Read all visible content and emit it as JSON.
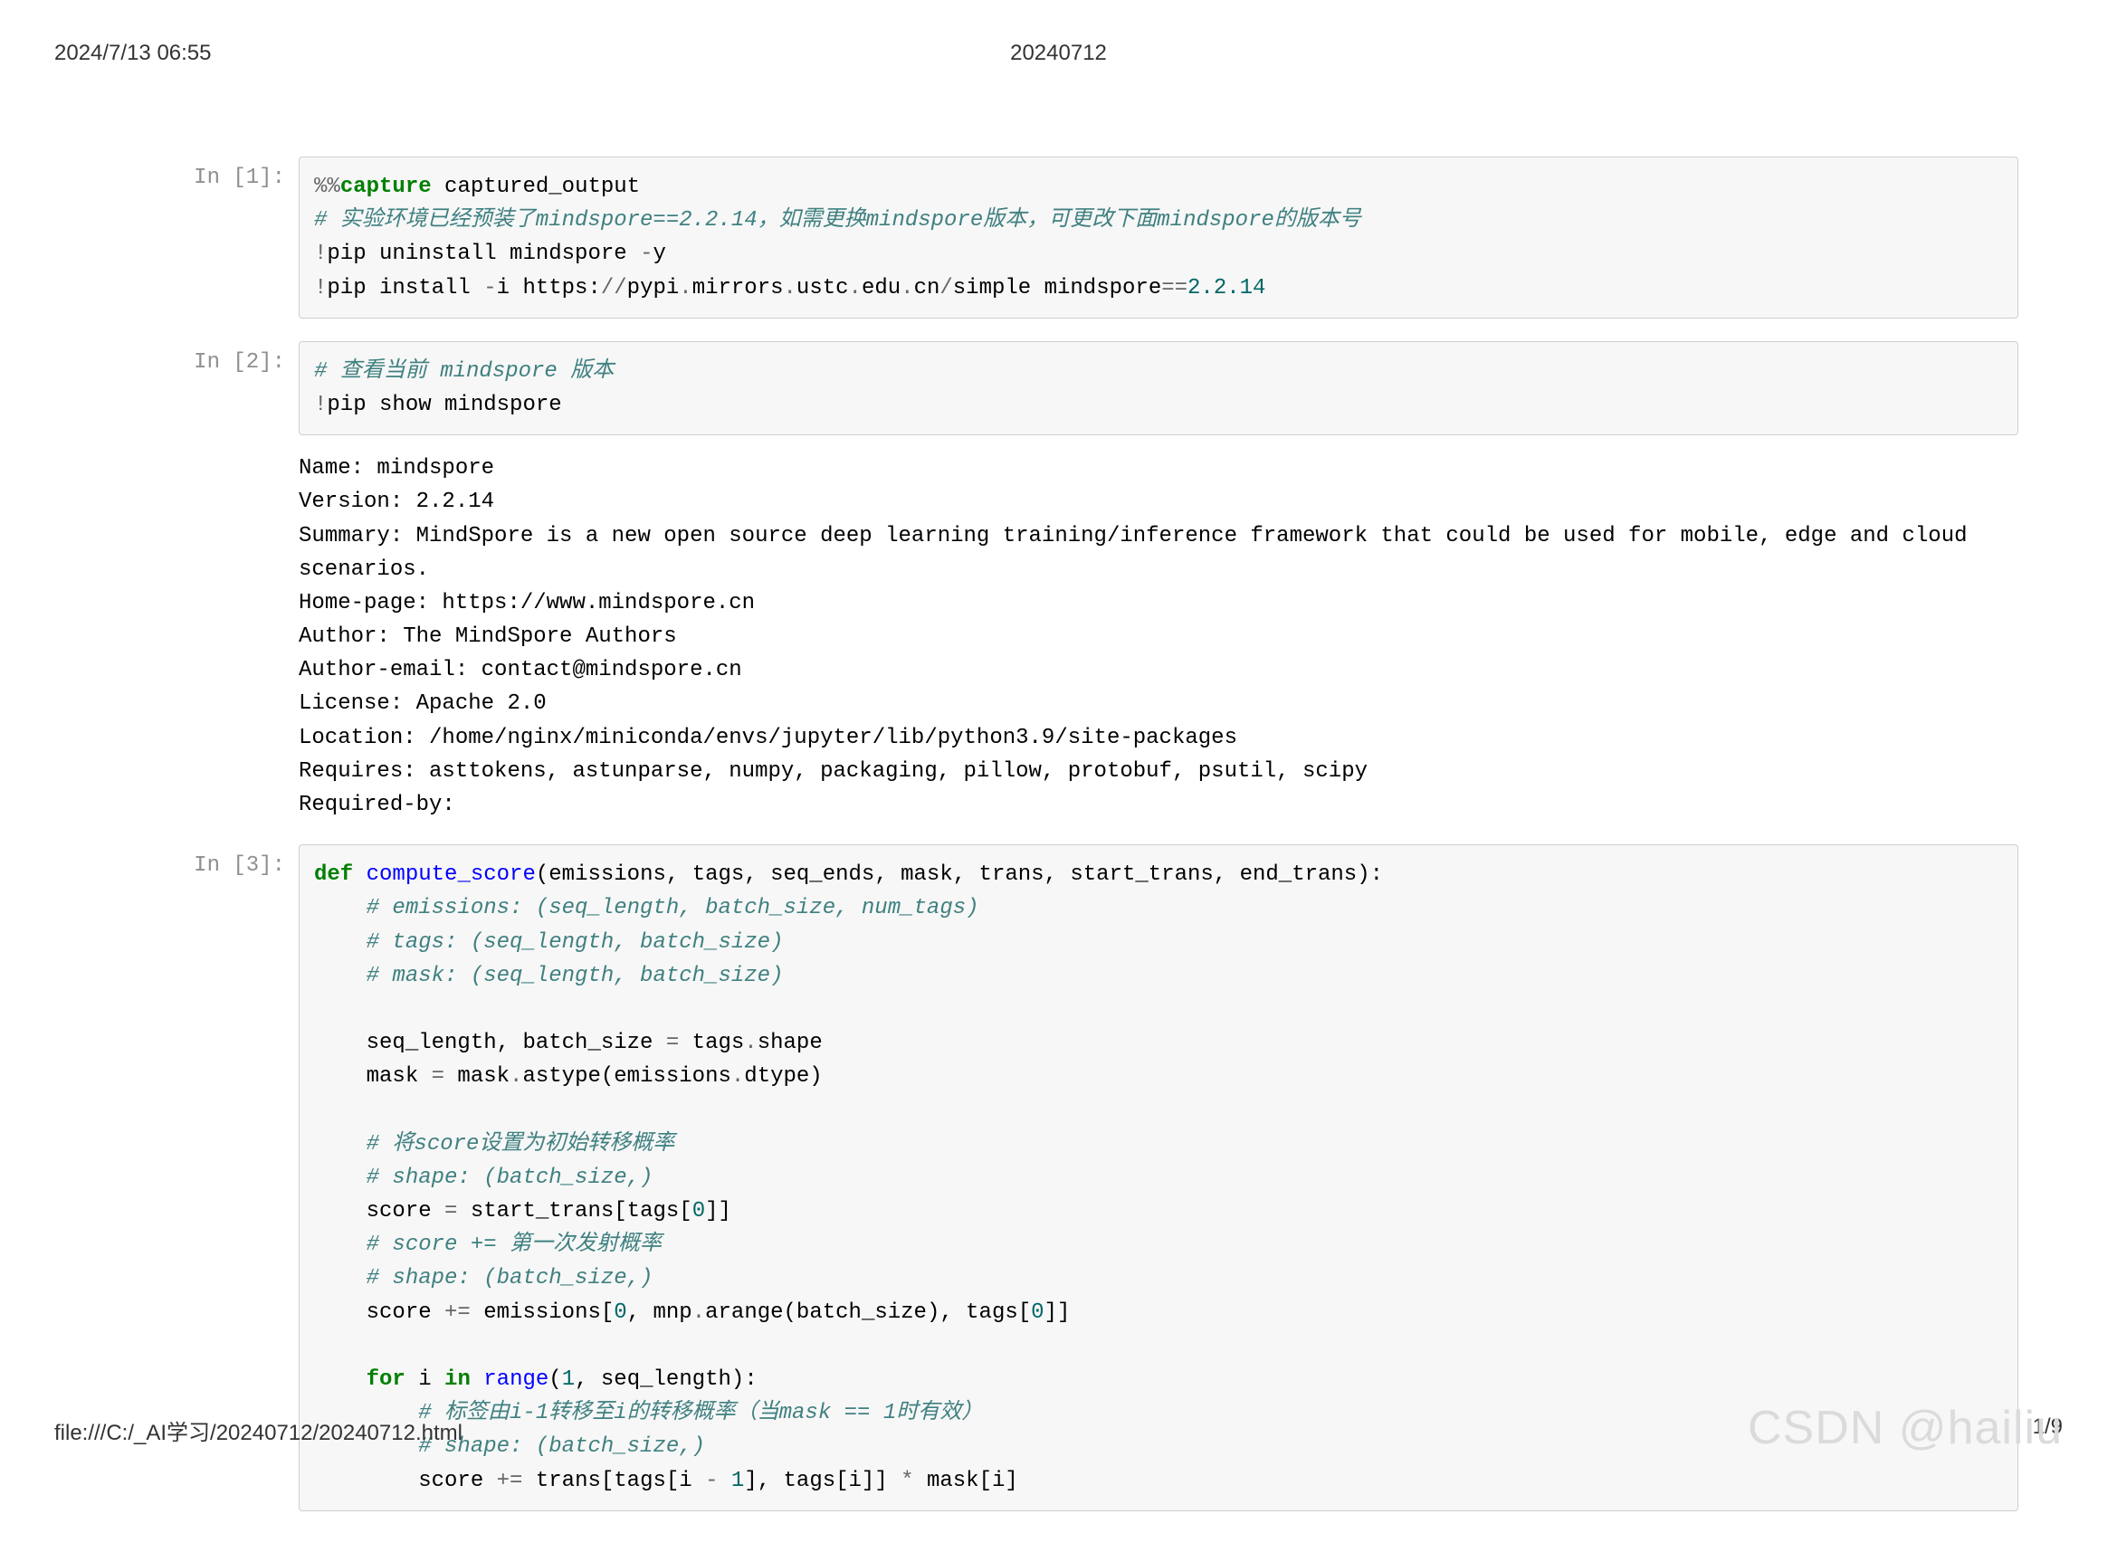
{
  "header": {
    "timestamp": "2024/7/13 06:55",
    "doc_title": "20240712"
  },
  "cells": [
    {
      "prompt": "In [1]:",
      "code_html": "<span class='c-op'>%%</span><span class='c-mg'>capture</span> captured_output\n<span class='c-cm'># 实验环境已经预装了mindspore==2.2.14，如需更换mindspore版本，可更改下面mindspore的版本号</span>\n<span class='c-op'>!</span>pip uninstall mindspore <span class='c-op'>-</span>y\n<span class='c-op'>!</span>pip install <span class='c-op'>-</span>i https:<span class='c-op'>//</span>pypi<span class='c-op'>.</span>mirrors<span class='c-op'>.</span>ustc<span class='c-op'>.</span>edu<span class='c-op'>.</span>cn<span class='c-op'>/</span>simple mindspore<span class='c-op'>==</span><span class='c-num'>2.2.14</span>"
    },
    {
      "prompt": "In [2]:",
      "code_html": "<span class='c-cm'># 查看当前 mindspore 版本</span>\n<span class='c-op'>!</span>pip show mindspore",
      "output": "Name: mindspore\nVersion: 2.2.14\nSummary: MindSpore is a new open source deep learning training/inference framework that could be used for mobile, edge and cloud scenarios.\nHome-page: https://www.mindspore.cn\nAuthor: The MindSpore Authors\nAuthor-email: contact@mindspore.cn\nLicense: Apache 2.0\nLocation: /home/nginx/miniconda/envs/jupyter/lib/python3.9/site-packages\nRequires: asttokens, astunparse, numpy, packaging, pillow, protobuf, psutil, scipy\nRequired-by:"
    },
    {
      "prompt": "In [3]:",
      "code_html": "<span class='c-kw'>def</span> <span class='c-nm'>compute_score</span>(emissions, tags, seq_ends, mask, trans, start_trans, end_trans):\n    <span class='c-cm'># emissions: (seq_length, batch_size, num_tags)</span>\n    <span class='c-cm'># tags: (seq_length, batch_size)</span>\n    <span class='c-cm'># mask: (seq_length, batch_size)</span>\n\n    seq_length, batch_size <span class='c-op'>=</span> tags<span class='c-op'>.</span>shape\n    mask <span class='c-op'>=</span> mask<span class='c-op'>.</span>astype(emissions<span class='c-op'>.</span>dtype)\n\n    <span class='c-cm'># 将score设置为初始转移概率</span>\n    <span class='c-cm'># shape: (batch_size,)</span>\n    score <span class='c-op'>=</span> start_trans[tags[<span class='c-num'>0</span>]]\n    <span class='c-cm'># score += 第一次发射概率</span>\n    <span class='c-cm'># shape: (batch_size,)</span>\n    score <span class='c-op'>+=</span> emissions[<span class='c-num'>0</span>, mnp<span class='c-op'>.</span>arange(batch_size), tags[<span class='c-num'>0</span>]]\n\n    <span class='c-kw'>for</span> i <span class='c-kw'>in</span> <span class='c-nm'>range</span>(<span class='c-num'>1</span>, seq_length):\n        <span class='c-cm'># 标签由i-1转移至i的转移概率（当mask == 1时有效）</span>\n        <span class='c-cm'># shape: (batch_size,)</span>\n        score <span class='c-op'>+=</span> trans[tags[i <span class='c-op'>-</span> <span class='c-num'>1</span>], tags[i]] <span class='c-op'>*</span> mask[i]"
    }
  ],
  "footer": {
    "path": "file:///C:/_AI学习/20240712/20240712.html",
    "page": "1/9"
  },
  "watermark": "CSDN @hailiu"
}
